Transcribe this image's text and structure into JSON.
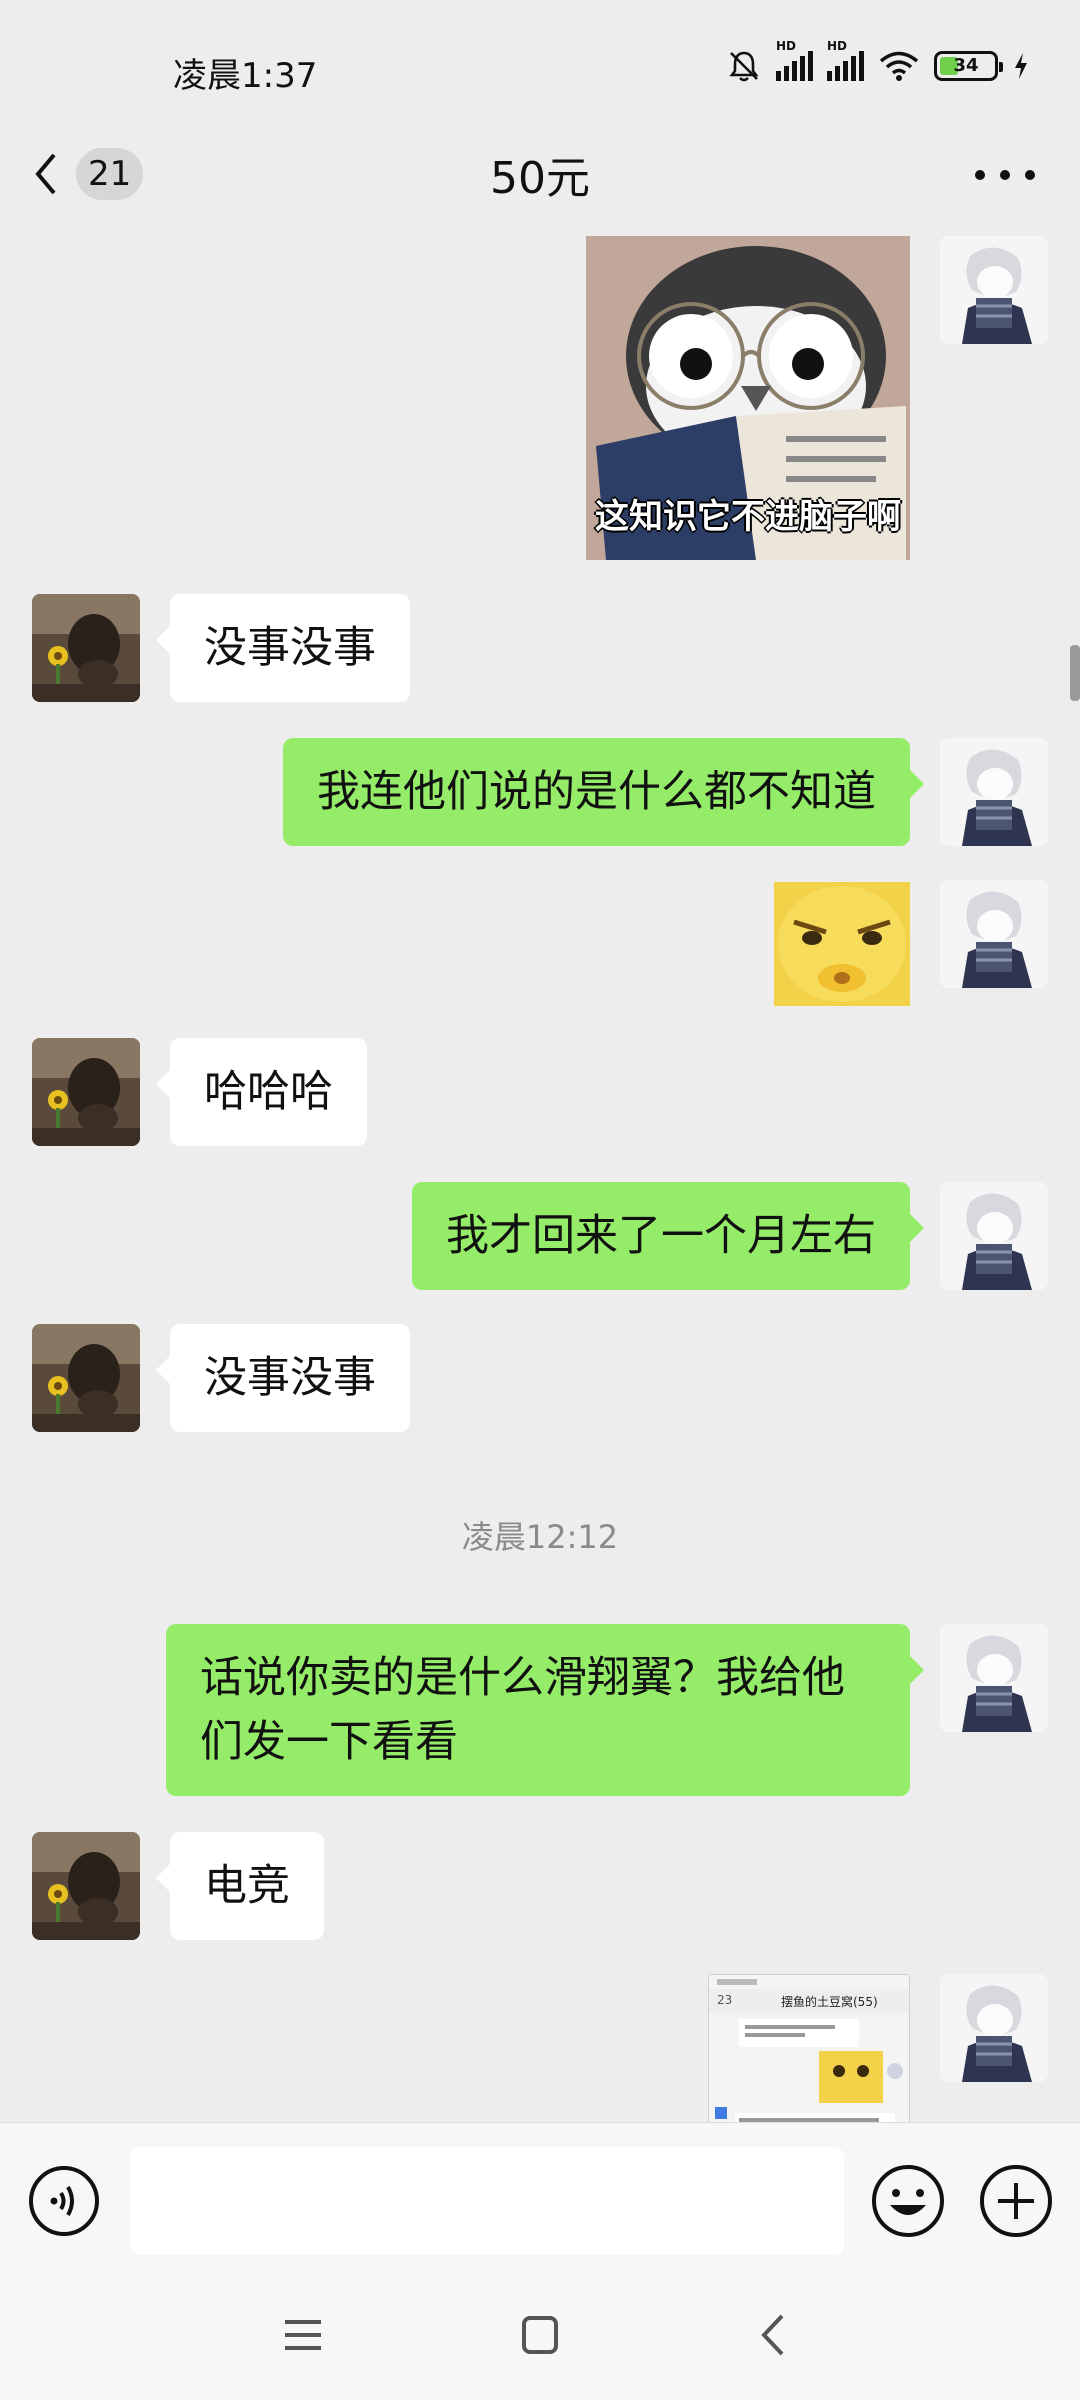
{
  "status_bar": {
    "time": "凌晨1:37",
    "signal_1_label": "HD",
    "signal_2_label": "HD",
    "battery_percent": "34",
    "battery_level": 0.34,
    "icons": [
      "bell-muted-icon",
      "signal-icon",
      "signal-icon",
      "wifi-icon",
      "battery-icon",
      "charging-icon"
    ]
  },
  "header": {
    "unread_count": "21",
    "title": "50元",
    "back_icon": "chevron-left-icon",
    "more_icon": "more-dots-icon"
  },
  "messages": [
    {
      "type": "sticker",
      "side": "out",
      "caption": "这知识它不进脑子啊",
      "icon": "penguin-glasses-sticker"
    },
    {
      "type": "text",
      "side": "in",
      "text": "没事没事"
    },
    {
      "type": "text",
      "side": "out",
      "text": "我连他们说的是什么都不知道"
    },
    {
      "type": "sticker",
      "side": "out",
      "icon": "yellow-face-sticker"
    },
    {
      "type": "text",
      "side": "in",
      "text": "哈哈哈"
    },
    {
      "type": "text",
      "side": "out",
      "text": "我才回来了一个月左右"
    },
    {
      "type": "text",
      "side": "in",
      "text": "没事没事"
    },
    {
      "type": "time",
      "text": "凌晨12:12"
    },
    {
      "type": "text",
      "side": "out",
      "text_line1": "话说你卖的是什么滑翔翼？我给他",
      "text_line2": "们发一下看看"
    },
    {
      "type": "text",
      "side": "in",
      "text": "电竞"
    },
    {
      "type": "image",
      "side": "out",
      "icon": "screenshot-thumbnail",
      "thumb_title": "摆鱼的土豆窝(55)",
      "thumb_count": "23"
    }
  ],
  "input_bar": {
    "placeholder": "",
    "voice_icon": "voice-icon",
    "emoji_icon": "emoji-icon",
    "plus_icon": "plus-icon"
  },
  "nav_bar": {
    "icons": [
      "menu-icon",
      "home-icon",
      "back-icon"
    ]
  },
  "colors": {
    "background": "#ededed",
    "outgoing_bubble": "#95ec69",
    "incoming_bubble": "#ffffff",
    "battery_fill": "#6fcf4a"
  }
}
